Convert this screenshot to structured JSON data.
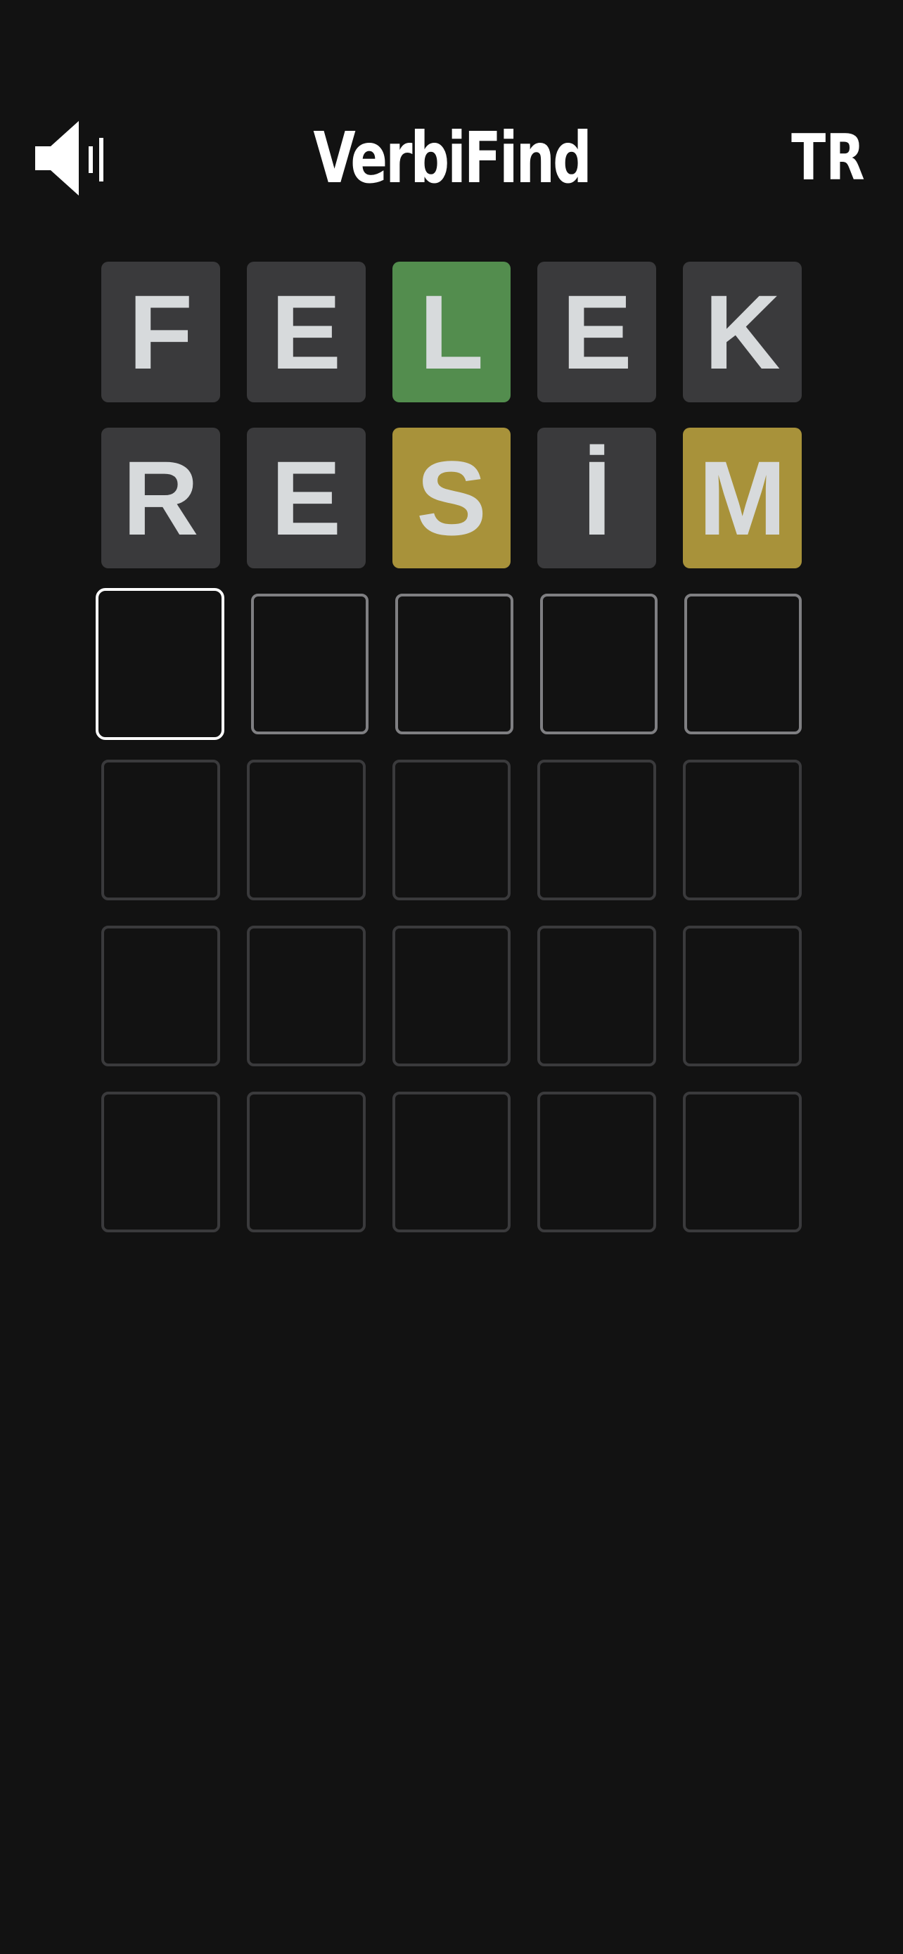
{
  "header": {
    "sound_icon": "speaker-volume-icon",
    "title": "VerbiFind",
    "language": "TR"
  },
  "board": {
    "rows": [
      {
        "state": "submitted",
        "tiles": [
          {
            "letter": "F",
            "status": "absent"
          },
          {
            "letter": "E",
            "status": "absent"
          },
          {
            "letter": "L",
            "status": "correct"
          },
          {
            "letter": "E",
            "status": "absent"
          },
          {
            "letter": "K",
            "status": "absent"
          }
        ]
      },
      {
        "state": "submitted",
        "tiles": [
          {
            "letter": "R",
            "status": "absent"
          },
          {
            "letter": "E",
            "status": "absent"
          },
          {
            "letter": "S",
            "status": "present"
          },
          {
            "letter": "İ",
            "status": "absent"
          },
          {
            "letter": "M",
            "status": "present"
          }
        ]
      },
      {
        "state": "current",
        "tiles": [
          {
            "letter": "",
            "status": "active"
          },
          {
            "letter": "",
            "status": "typing"
          },
          {
            "letter": "",
            "status": "typing"
          },
          {
            "letter": "",
            "status": "typing"
          },
          {
            "letter": "",
            "status": "typing"
          }
        ]
      },
      {
        "state": "empty",
        "tiles": [
          {
            "letter": "",
            "status": "empty"
          },
          {
            "letter": "",
            "status": "empty"
          },
          {
            "letter": "",
            "status": "empty"
          },
          {
            "letter": "",
            "status": "empty"
          },
          {
            "letter": "",
            "status": "empty"
          }
        ]
      },
      {
        "state": "empty",
        "tiles": [
          {
            "letter": "",
            "status": "empty"
          },
          {
            "letter": "",
            "status": "empty"
          },
          {
            "letter": "",
            "status": "empty"
          },
          {
            "letter": "",
            "status": "empty"
          },
          {
            "letter": "",
            "status": "empty"
          }
        ]
      },
      {
        "state": "empty",
        "tiles": [
          {
            "letter": "",
            "status": "empty"
          },
          {
            "letter": "",
            "status": "empty"
          },
          {
            "letter": "",
            "status": "empty"
          },
          {
            "letter": "",
            "status": "empty"
          },
          {
            "letter": "",
            "status": "empty"
          }
        ]
      }
    ]
  },
  "colors": {
    "background": "#121212",
    "absent": "#3a3a3c",
    "correct": "#538d4e",
    "present": "#a8923a",
    "letter": "#d7dadc"
  }
}
